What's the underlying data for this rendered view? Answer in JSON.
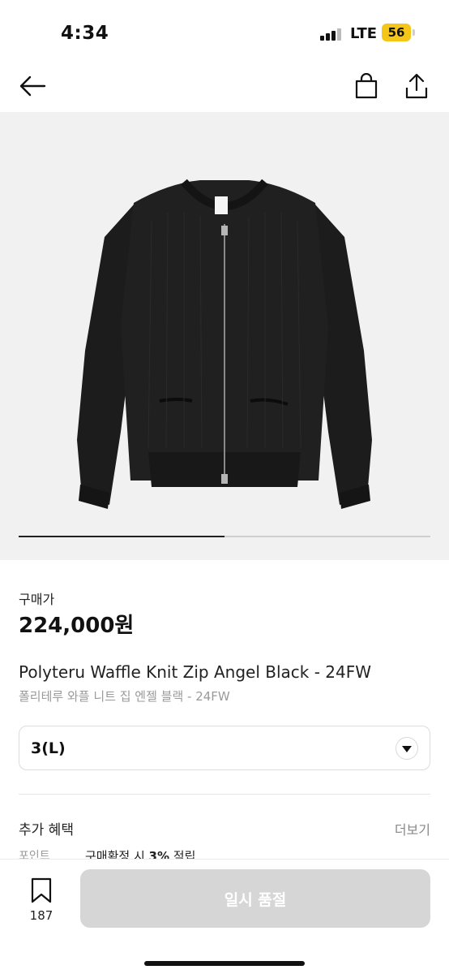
{
  "status_bar": {
    "time": "4:34",
    "network": "LTE",
    "battery": "56",
    "battery_color": "#f5c518"
  },
  "nav": {
    "back_icon": "arrow-left-icon",
    "bag_icon": "shopping-bag-icon",
    "share_icon": "share-icon"
  },
  "gallery": {
    "image_subject": "black zip-up waffle knit cardigan",
    "background": "#f1f1f1",
    "progress": 0.5
  },
  "price": {
    "label": "구매가",
    "value": "224,000원"
  },
  "product": {
    "title_en": "Polyteru Waffle Knit Zip Angel Black - 24FW",
    "title_ko": "폴리테루 와플 니트 집 엔젤 블랙 - 24FW"
  },
  "size_select": {
    "value": "3(L)",
    "icon": "chevron-down-icon"
  },
  "benefits": {
    "title": "추가 혜택",
    "more": "더보기",
    "rows": [
      {
        "label": "포인트",
        "text_pre": "구매확정 시 ",
        "text_bold": "3%",
        "text_post": " 적립"
      }
    ]
  },
  "bottom_bar": {
    "wish_icon": "bookmark-icon",
    "wish_count": "187",
    "cta_label": "일시 품절",
    "cta_color": "#d6d6d6"
  }
}
